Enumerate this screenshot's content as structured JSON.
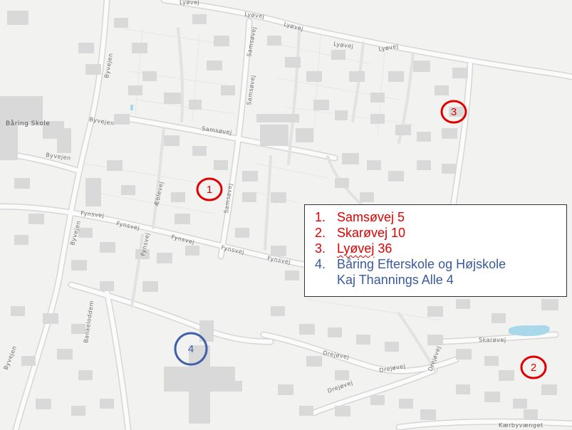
{
  "map": {
    "place_labels": {
      "school": "Båring Skole"
    },
    "street_labels": {
      "lyovej_1": "Lyøvej",
      "lyovej_2": "Lyøvej",
      "lyovej_3": "Lyøvej",
      "lyovej_4": "Lyøvej",
      "lyovej_5": "Lyøvej",
      "samsovej_1": "Samsøvej",
      "samsovej_2": "Samsøvej",
      "samsovej_3": "Samsøvej",
      "samsovej_4": "Samsøvej",
      "byvejen_1": "Byvejen",
      "byvejen_2": "Byvejen",
      "byvejen_3": "Byvejen",
      "byvejen_4": "Byvejen",
      "byvejen_5": "Byvejen",
      "fynsvej_1": "Fynsvej",
      "fynsvej_2": "Fynsvej",
      "fynsvej_3": "Fynsvej",
      "fynsvej_4": "Fynsvej",
      "fynsvej_5": "Fynsvej",
      "fynsvej_6": "Fynsvej",
      "aeblevej": "Æblevej",
      "bankeloddem": "Bankeloddem",
      "drejovej_1": "Drejøvej",
      "drejovej_2": "Drejøvej",
      "drejovej_3": "Drejøvej",
      "drejovej_4": "Drejøvej",
      "skarovej": "Skarøvej",
      "kaerbyvaenget": "Kærbyvænget"
    },
    "markers": [
      {
        "number": "1",
        "color": "#e00000"
      },
      {
        "number": "2",
        "color": "#e00000"
      },
      {
        "number": "3",
        "color": "#e00000"
      },
      {
        "number": "4",
        "color": "#4060a8"
      }
    ]
  },
  "legend": {
    "items": [
      {
        "number": "1.",
        "lines": [
          "Samsøvej 5"
        ],
        "color": "#e00000"
      },
      {
        "number": "2.",
        "lines": [
          "Skarøvej 10"
        ],
        "color": "#e00000"
      },
      {
        "number": "3.",
        "lines": [
          "Lyøvej 36"
        ],
        "color": "#e00000"
      },
      {
        "number": "4.",
        "lines": [
          "Båring Efterskole og Højskole",
          "Kaj Thannings Alle 4"
        ],
        "color": "#3a5a9c"
      }
    ]
  },
  "colors": {
    "background": "#f2f2f1",
    "building": "#d9d9d9",
    "road_casing": "#d0d0d0",
    "water": "#a8d8ea"
  }
}
